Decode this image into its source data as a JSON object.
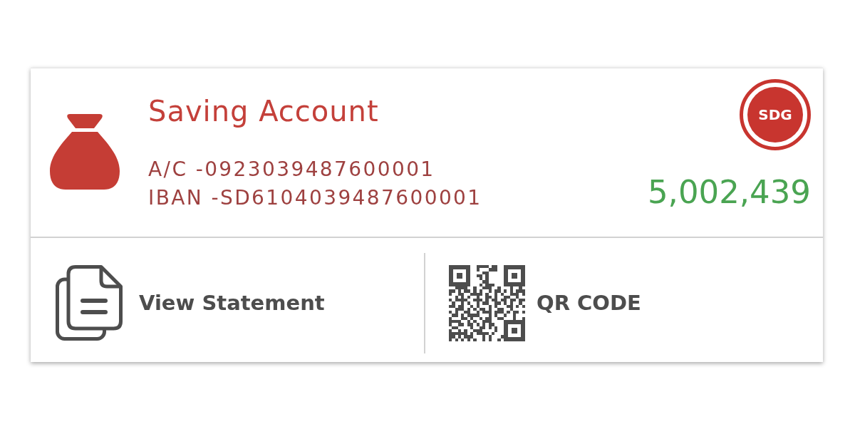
{
  "account": {
    "title": "Saving Account",
    "account_number": "A/C -0923039487600001",
    "iban": "IBAN -SD6104039487600001",
    "currency_badge": "SDG",
    "balance": "5,002,439"
  },
  "actions": [
    {
      "kind": "statement",
      "label": "View Statement"
    },
    {
      "kind": "qr",
      "label": "QR CODE"
    }
  ]
}
